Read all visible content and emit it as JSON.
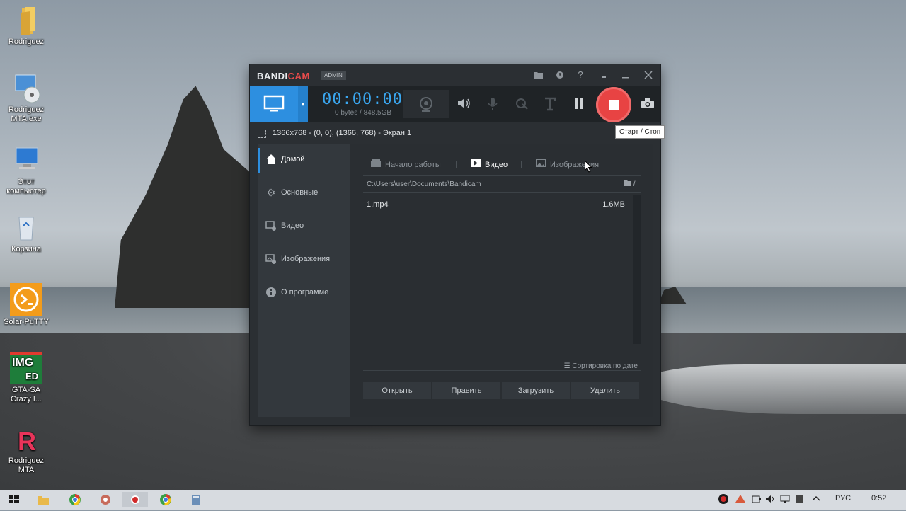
{
  "desktop": {
    "icons": [
      {
        "label": "Rodriguez"
      },
      {
        "label": "Rodriguez MTA.exe"
      },
      {
        "label": "Этот компьютер"
      },
      {
        "label": "Корзина"
      },
      {
        "label": "Solar-PuTTY"
      },
      {
        "label": "GTA-SA Crazy I..."
      },
      {
        "label": "Rodriguez MTA"
      }
    ]
  },
  "window": {
    "app_name": "BANDICAM",
    "app_name_accent": "CAM",
    "app_name_main": "BANDI",
    "admin_badge": "ADMIN",
    "timer": "00:00:00",
    "bytes": "0 bytes / 848.5GB",
    "region": "1366x768 - (0, 0), (1366, 768) - Экран 1",
    "tooltip": "Старт / Стоп",
    "sidebar": [
      {
        "label": "Домой",
        "icon": "home-icon"
      },
      {
        "label": "Основные",
        "icon": "gear-icon"
      },
      {
        "label": "Видео",
        "icon": "video-settings-icon"
      },
      {
        "label": "Изображения",
        "icon": "image-settings-icon"
      },
      {
        "label": "О программе",
        "icon": "info-icon"
      }
    ],
    "tabs": [
      {
        "label": "Начало работы"
      },
      {
        "label": "Видео"
      },
      {
        "label": "Изображения"
      }
    ],
    "path": "C:\\Users\\user\\Documents\\Bandicam",
    "path_suffix": "/",
    "files": [
      {
        "name": "1.mp4",
        "size": "1.6MB"
      }
    ],
    "sort_label": "Сортировка по дате",
    "buttons": {
      "open": "Открыть",
      "edit": "Править",
      "upload": "Загрузить",
      "delete": "Удалить"
    },
    "colors": {
      "accent": "#2d8fe0",
      "record": "#e84343",
      "timer": "#3aa7f0"
    }
  },
  "taskbar": {
    "language": "РУС",
    "time": "0:52"
  }
}
